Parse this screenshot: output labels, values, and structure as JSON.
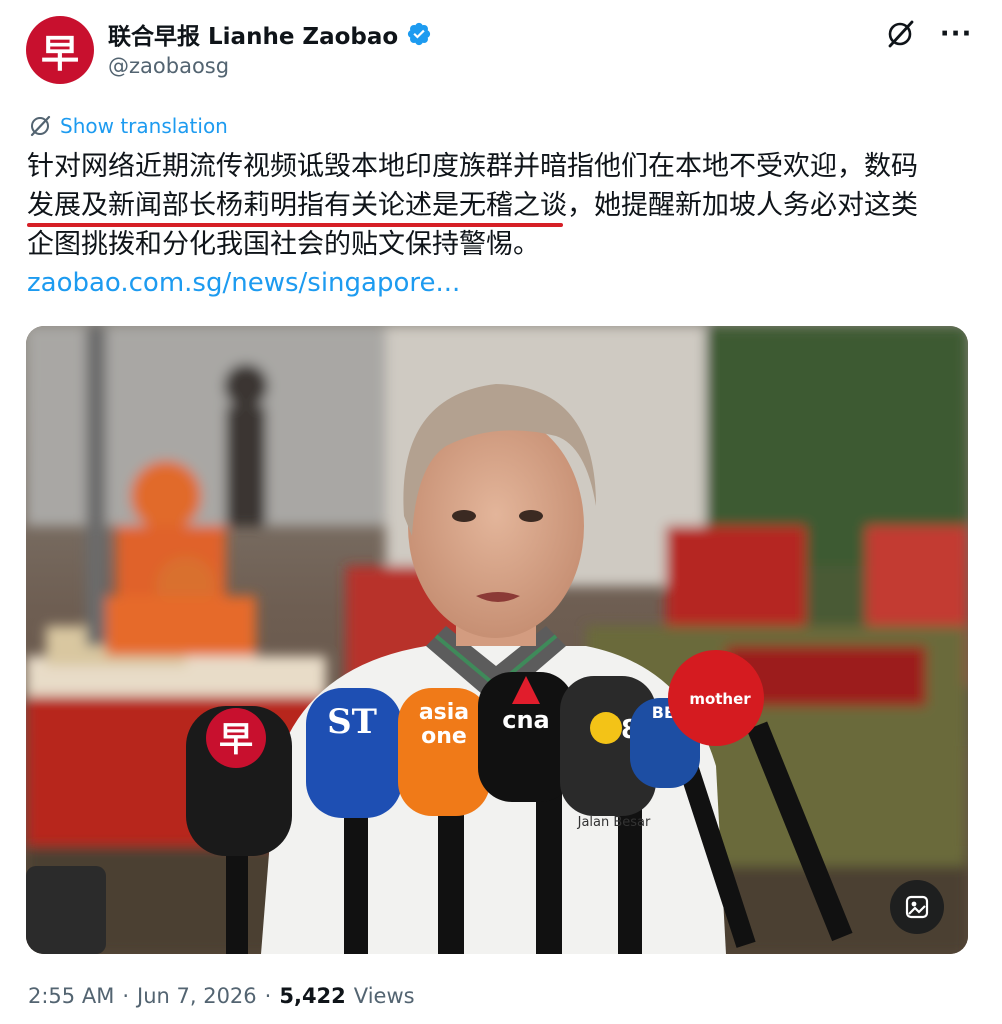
{
  "account": {
    "avatar_glyph": "早",
    "display_name": "联合早报 Lianhe Zaobao",
    "handle": "@zaobaosg",
    "verified_color": "#1d9bf0",
    "avatar_color": "#c8102e"
  },
  "actions": {
    "grok_icon": "grok-icon",
    "more_label": "···"
  },
  "translation": {
    "label": "Show translation"
  },
  "tweet": {
    "line1": "针对网络近期流传视频诋毁本地印度族群并暗指他们在本地不受欢迎，数码",
    "line2_underlined": "发展及新闻部长杨莉明指有关论述是无稽之谈",
    "line2_rest": "，她提醒新加坡人务必对这类",
    "line3": "企图挑拨和分化我国社会的贴文保持警惕。",
    "link": "zaobao.com.sg/news/singapore..."
  },
  "media": {
    "mic_labels": {
      "zaobao": "早",
      "st": "ST",
      "asiaone_top": "asia",
      "asiaone_bottom": "one",
      "cna": "cna",
      "ch8": "8",
      "bbc": "BB",
      "mothership": "mother"
    },
    "shirt_text": "Jalan Besar",
    "media_button_icon": "image-edit-icon"
  },
  "meta": {
    "time": "2:55 AM",
    "dot": "·",
    "date": "Jun 7, 2026",
    "views_count": "5,422",
    "views_label": "Views"
  }
}
